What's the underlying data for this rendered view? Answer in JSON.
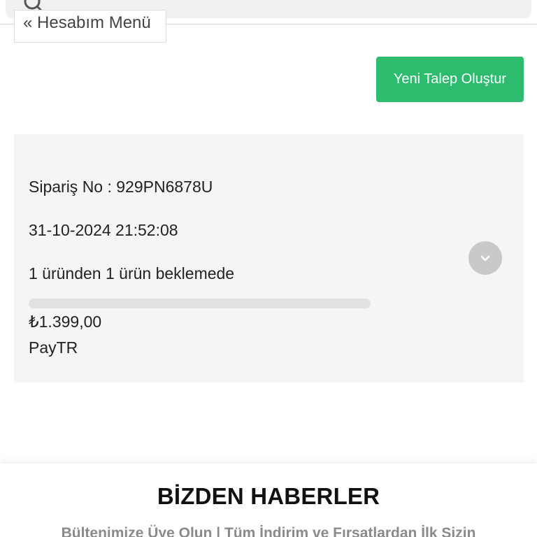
{
  "account_menu": {
    "label": "« Hesabım Menü"
  },
  "new_request_button": {
    "label": "Yeni Talep Oluştur"
  },
  "order": {
    "order_no": "Sipariş No : 929PN6878U",
    "date": "31-10-2024 21:52:08",
    "status": "1 üründen 1 ürün beklemede",
    "progress_fraction": 0,
    "total": "₺1.399,00",
    "payment": "PayTR"
  },
  "footer": {
    "title": "BİZDEN HABERLER",
    "subtitle": "Bültenimize Üye Olun | Tüm İndirim ve Fırsatlardan İlk Sizin"
  },
  "colors": {
    "accent": "#2dbb6e",
    "card_bg": "#f5f5f5",
    "expand_button": "#c9c9c9"
  },
  "icons": {
    "search": "search-icon",
    "expand": "chevron-down-icon"
  }
}
